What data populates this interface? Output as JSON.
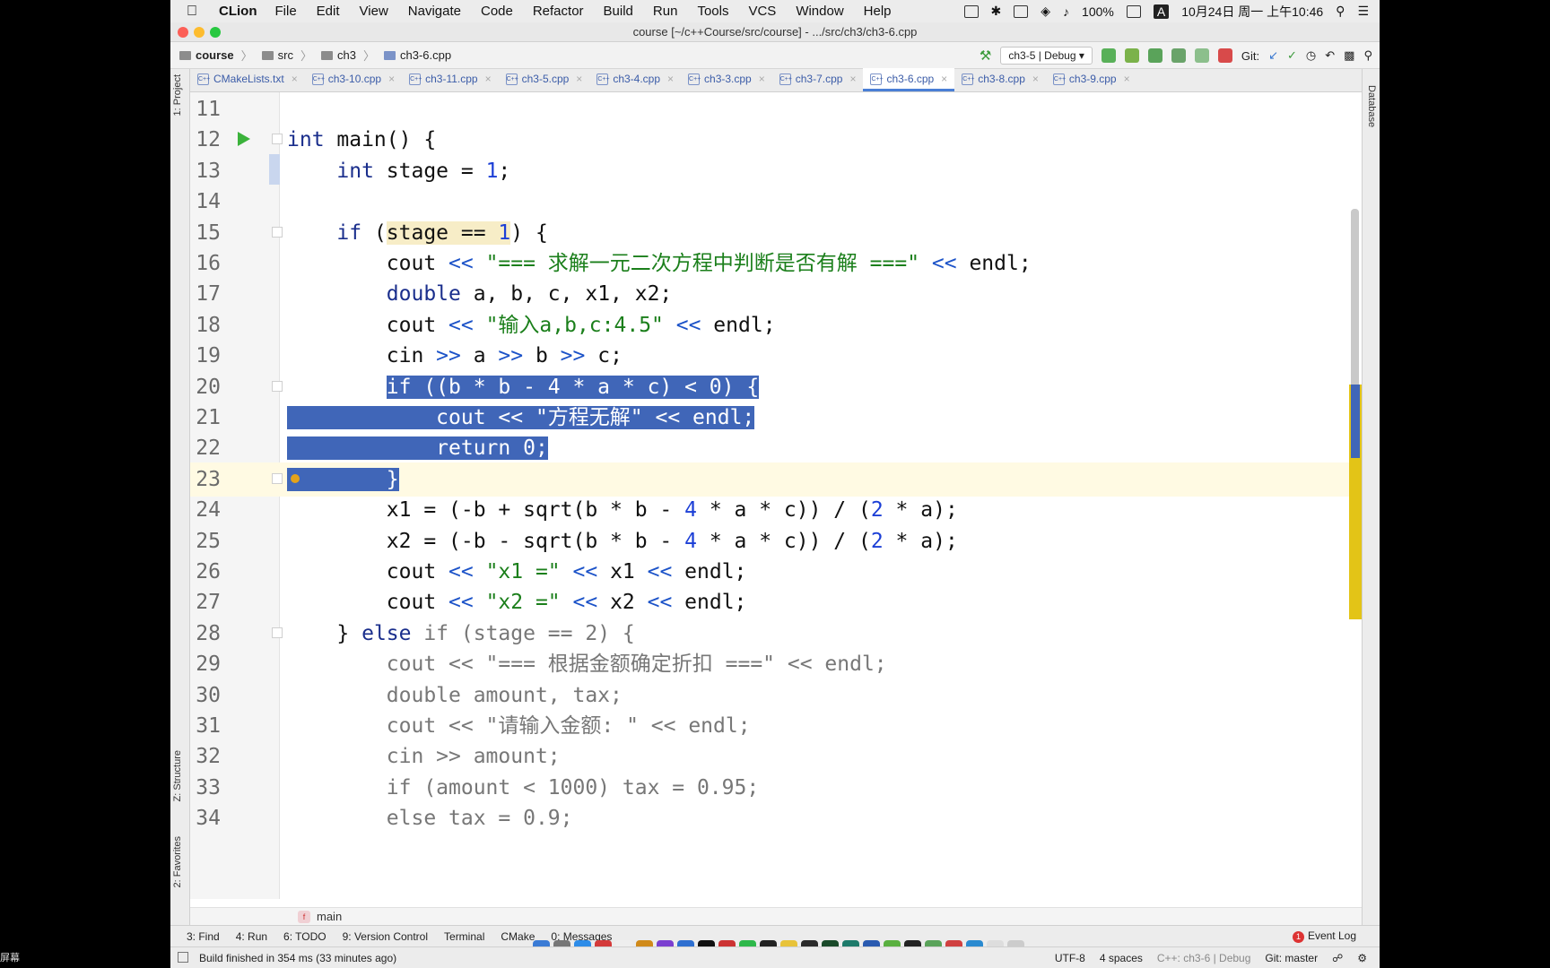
{
  "menubar": {
    "app": "CLion",
    "menus": [
      "File",
      "Edit",
      "View",
      "Navigate",
      "Code",
      "Refactor",
      "Build",
      "Run",
      "Tools",
      "VCS",
      "Window",
      "Help"
    ],
    "battery": "100%",
    "input_badge": "A",
    "datetime": "10月24日 周一 上午10:46"
  },
  "window_title": "course [~/c++Course/src/course] - .../src/ch3/ch3-6.cpp",
  "navbar": {
    "breadcrumbs": [
      "course",
      "src",
      "ch3",
      "ch3-6.cpp"
    ],
    "run_config": "ch3-5 | Debug",
    "git_label": "Git:"
  },
  "tabs": [
    {
      "label": "CMakeLists.txt"
    },
    {
      "label": "ch3-10.cpp"
    },
    {
      "label": "ch3-11.cpp"
    },
    {
      "label": "ch3-5.cpp"
    },
    {
      "label": "ch3-4.cpp"
    },
    {
      "label": "ch3-3.cpp"
    },
    {
      "label": "ch3-7.cpp"
    },
    {
      "label": "ch3-6.cpp"
    },
    {
      "label": "ch3-8.cpp"
    },
    {
      "label": "ch3-9.cpp"
    }
  ],
  "side_panels": {
    "project": "1: Project",
    "structure": "Z: Structure",
    "favorites": "2: Favorites",
    "database": "Database"
  },
  "editor": {
    "lines": [
      {
        "n": "11",
        "segments": []
      },
      {
        "n": "12",
        "segments": [
          [
            "kw",
            "int"
          ],
          [
            "t",
            " main() {"
          ]
        ]
      },
      {
        "n": "13",
        "segments": [
          [
            "t",
            "    "
          ],
          [
            "kw",
            "int"
          ],
          [
            "t",
            " stage = "
          ],
          [
            "num",
            "1"
          ],
          [
            "t",
            ";"
          ]
        ]
      },
      {
        "n": "14",
        "segments": []
      },
      {
        "n": "15",
        "segments": [
          [
            "t",
            "    "
          ],
          [
            "kw",
            "if"
          ],
          [
            "t",
            " ("
          ],
          [
            "hl",
            "stage == "
          ],
          [
            "hlnum",
            "1"
          ],
          [
            "t",
            ") {"
          ]
        ]
      },
      {
        "n": "16",
        "segments": [
          [
            "t",
            "        cout "
          ],
          [
            "op",
            "<<"
          ],
          [
            "str",
            " \"=== 求解一元二次方程中判断是否有解 ===\""
          ],
          [
            "t",
            " "
          ],
          [
            "op",
            "<<"
          ],
          [
            "t",
            " endl;"
          ]
        ]
      },
      {
        "n": "17",
        "segments": [
          [
            "t",
            "        "
          ],
          [
            "kw",
            "double"
          ],
          [
            "t",
            " a, b, c, x1, x2;"
          ]
        ]
      },
      {
        "n": "18",
        "segments": [
          [
            "t",
            "        cout "
          ],
          [
            "op",
            "<<"
          ],
          [
            "str",
            " \"输入a,b,c:4.5\""
          ],
          [
            "t",
            " "
          ],
          [
            "op",
            "<<"
          ],
          [
            "t",
            " endl;"
          ]
        ]
      },
      {
        "n": "19",
        "segments": [
          [
            "t",
            "        cin "
          ],
          [
            "op",
            ">>"
          ],
          [
            "t",
            " a "
          ],
          [
            "op",
            ">>"
          ],
          [
            "t",
            " b "
          ],
          [
            "op",
            ">>"
          ],
          [
            "t",
            " c;"
          ]
        ]
      },
      {
        "n": "20",
        "segments": [
          [
            "t",
            "        "
          ],
          [
            "sel",
            "if ((b * b - 4 * a * c) < 0) {"
          ]
        ]
      },
      {
        "n": "21",
        "segments": [
          [
            "sel",
            "            cout << \"方程无解\" << endl;"
          ]
        ]
      },
      {
        "n": "22",
        "segments": [
          [
            "sel",
            "            return 0;"
          ]
        ]
      },
      {
        "n": "23",
        "segments": [
          [
            "sel",
            "        }"
          ]
        ]
      },
      {
        "n": "24",
        "segments": [
          [
            "t",
            "        x1 = (-b + sqrt(b * b - "
          ],
          [
            "num",
            "4"
          ],
          [
            "t",
            " * a * c)) / ("
          ],
          [
            "num",
            "2"
          ],
          [
            "t",
            " * a);"
          ]
        ]
      },
      {
        "n": "25",
        "segments": [
          [
            "t",
            "        x2 = (-b - sqrt(b * b - "
          ],
          [
            "num",
            "4"
          ],
          [
            "t",
            " * a * c)) / ("
          ],
          [
            "num",
            "2"
          ],
          [
            "t",
            " * a);"
          ]
        ]
      },
      {
        "n": "26",
        "segments": [
          [
            "t",
            "        cout "
          ],
          [
            "op",
            "<<"
          ],
          [
            "str",
            " \"x1 =\""
          ],
          [
            "t",
            " "
          ],
          [
            "op",
            "<<"
          ],
          [
            "t",
            " x1 "
          ],
          [
            "op",
            "<<"
          ],
          [
            "t",
            " endl;"
          ]
        ]
      },
      {
        "n": "27",
        "segments": [
          [
            "t",
            "        cout "
          ],
          [
            "op",
            "<<"
          ],
          [
            "str",
            " \"x2 =\""
          ],
          [
            "t",
            " "
          ],
          [
            "op",
            "<<"
          ],
          [
            "t",
            " x2 "
          ],
          [
            "op",
            "<<"
          ],
          [
            "t",
            " endl;"
          ]
        ]
      },
      {
        "n": "28",
        "segments": [
          [
            "t",
            "    } "
          ],
          [
            "kw",
            "else"
          ],
          [
            "dim",
            " if (stage == 2) {"
          ]
        ]
      },
      {
        "n": "29",
        "segments": [
          [
            "dim",
            "        cout << \"=== 根据金额确定折扣 ===\" << endl;"
          ]
        ]
      },
      {
        "n": "30",
        "segments": [
          [
            "dim",
            "        double amount, tax;"
          ]
        ]
      },
      {
        "n": "31",
        "segments": [
          [
            "dim",
            "        cout << \"请输入金额: \" << endl;"
          ]
        ]
      },
      {
        "n": "32",
        "segments": [
          [
            "dim",
            "        cin >> amount;"
          ]
        ]
      },
      {
        "n": "33",
        "segments": [
          [
            "dim",
            "        if (amount < 1000) tax = 0.95;"
          ]
        ]
      },
      {
        "n": "34",
        "segments": [
          [
            "dim",
            "        else tax = 0.9;"
          ]
        ]
      }
    ]
  },
  "editor_breadcrumb": "main",
  "tool_windows": [
    "3: Find",
    "4: Run",
    "6: TODO",
    "9: Version Control",
    "Terminal",
    "CMake",
    "0: Messages"
  ],
  "event_log": "Event Log",
  "event_log_count": "1",
  "status": {
    "message": "Build finished in 354 ms (33 minutes ago)",
    "encoding": "UTF-8",
    "indent": "4 spaces",
    "context": "C++: ch3-6 | Debug",
    "git": "Git: master"
  },
  "screen_corner_label": "屏幕",
  "colors": {
    "selection": "#4066b8",
    "keyword": "#1a2e8c",
    "string": "#1b7f1b",
    "number": "#1c3fd6",
    "marker_stripe": "#e3c417",
    "run_icon": "#3bb23b"
  }
}
